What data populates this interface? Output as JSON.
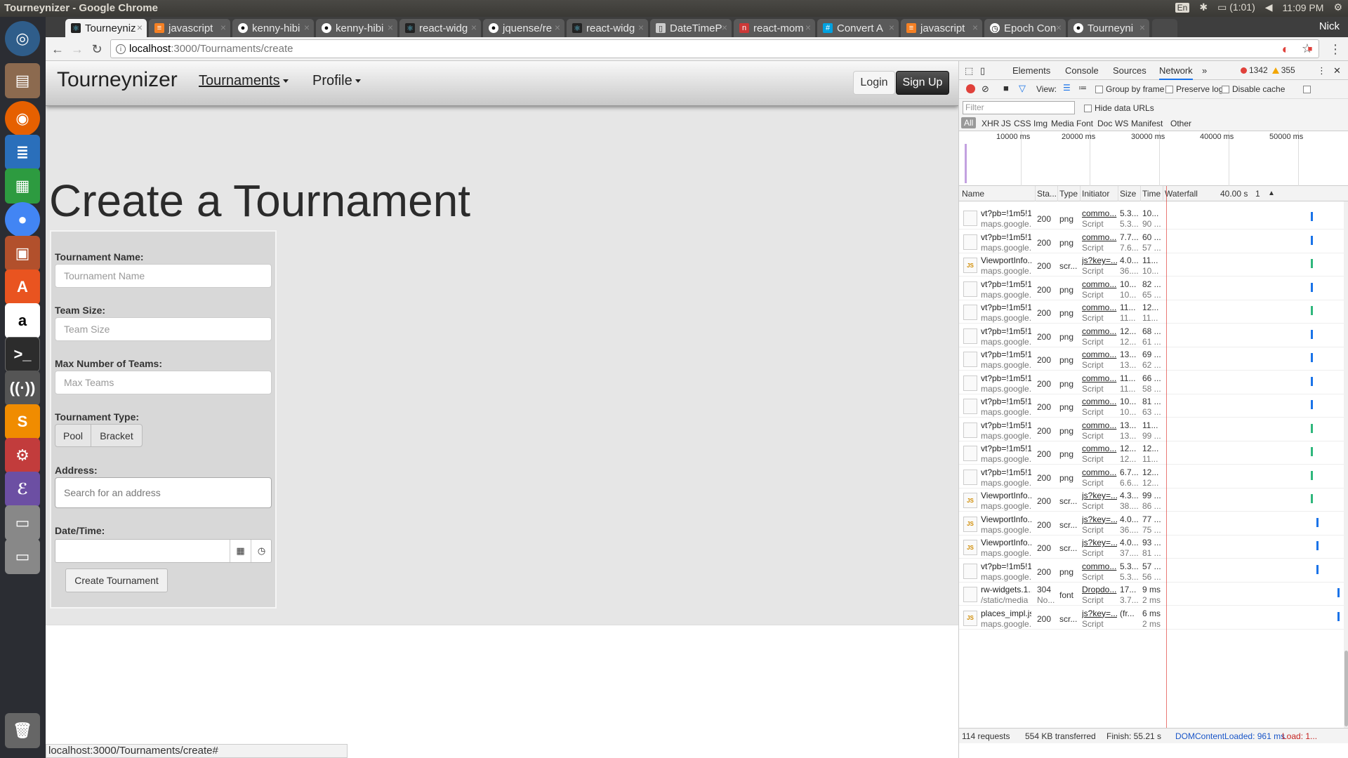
{
  "os": {
    "window_title": "Tourneynizer - Google Chrome",
    "keyboard": "En",
    "battery": "(1:01)",
    "clock": "11:09 PM",
    "user": "Nick"
  },
  "launcher": {
    "items": [
      "ubuntu-dash",
      "files",
      "firefox",
      "libreoffice-writer",
      "libreoffice-calc",
      "chrome",
      "libreoffice-impress",
      "software-center",
      "amazon",
      "terminal",
      "wifi",
      "sublime-text",
      "system-settings",
      "emacs",
      "drive",
      "drive-2",
      "trash"
    ]
  },
  "browser": {
    "tabs": [
      {
        "label": "Tourneyniz",
        "active": true
      },
      {
        "label": "javascript"
      },
      {
        "label": "kenny-hibi"
      },
      {
        "label": "kenny-hibi"
      },
      {
        "label": "react-widg"
      },
      {
        "label": "jquense/re"
      },
      {
        "label": "react-widg"
      },
      {
        "label": "DateTimeP"
      },
      {
        "label": "react-mom"
      },
      {
        "label": "Convert A"
      },
      {
        "label": "javascript"
      },
      {
        "label": "Epoch Con"
      },
      {
        "label": "Tourneyni"
      }
    ],
    "profile": "Nick",
    "url_host": "localhost",
    "url_path": ":3000/Tournaments/create",
    "status_url": "localhost:3000/Tournaments/create#"
  },
  "app": {
    "brand": "Tourneynizer",
    "nav": {
      "tournaments": "Tournaments",
      "profile": "Profile"
    },
    "login": "Login",
    "signup": "Sign Up",
    "page_title": "Create a Tournament",
    "form": {
      "name_label": "Tournament Name:",
      "name_placeholder": "Tournament Name",
      "team_size_label": "Team Size:",
      "team_size_placeholder": "Team Size",
      "max_teams_label": "Max Number of Teams:",
      "max_teams_placeholder": "Max Teams",
      "type_label": "Tournament Type:",
      "type_options": [
        "Pool",
        "Bracket"
      ],
      "address_label": "Address:",
      "address_placeholder": "Search for an address",
      "datetime_label": "Date/Time:",
      "submit": "Create Tournament"
    }
  },
  "devtools": {
    "tabs": [
      "Elements",
      "Console",
      "Sources",
      "Network"
    ],
    "active_tab": "Network",
    "errors": "1342",
    "warnings": "355",
    "view_label": "View:",
    "group_by_frame": "Group by frame",
    "preserve_log": "Preserve log",
    "disable_cache": "Disable cache",
    "filter_placeholder": "Filter",
    "hide_data_urls": "Hide data URLs",
    "filter_types": [
      "All",
      "XHR",
      "JS",
      "CSS",
      "Img",
      "Media",
      "Font",
      "Doc",
      "WS",
      "Manifest",
      "Other"
    ],
    "timeline_labels": [
      "10000 ms",
      "20000 ms",
      "30000 ms",
      "40000 ms",
      "50000 ms"
    ],
    "columns": [
      "Name",
      "Sta...",
      "Type",
      "Initiator",
      "Size",
      "Time",
      "Waterfall"
    ],
    "waterfall_scale": "40.00 s",
    "waterfall_page": "1",
    "requests": [
      {
        "name": "vt?pb=!1m5!1...",
        "domain": "maps.google...",
        "status": "200",
        "type": "png",
        "initiator": "commo...",
        "init_type": "Script",
        "size1": "5.3...",
        "size2": "5.3...",
        "time1": "10...",
        "time2": "90 ...",
        "wf": 0.84,
        "color": "#1a73e8"
      },
      {
        "name": "vt?pb=!1m5!1...",
        "domain": "maps.google...",
        "status": "200",
        "type": "png",
        "initiator": "commo...",
        "init_type": "Script",
        "size1": "7.7...",
        "size2": "7.6...",
        "time1": "60 ...",
        "time2": "57 ...",
        "wf": 0.84,
        "color": "#1a73e8"
      },
      {
        "name": "ViewportInfo...",
        "domain": "maps.google...",
        "status": "200",
        "type": "scr...",
        "initiator": "js?key=...",
        "init_type": "Script",
        "size1": "4.0...",
        "size2": "36....",
        "time1": "11...",
        "time2": "10...",
        "wf": 0.84,
        "color": "#2fb77c",
        "js": true
      },
      {
        "name": "vt?pb=!1m5!1...",
        "domain": "maps.google...",
        "status": "200",
        "type": "png",
        "initiator": "commo...",
        "init_type": "Script",
        "size1": "10...",
        "size2": "10...",
        "time1": "82 ...",
        "time2": "65 ...",
        "wf": 0.84,
        "color": "#1a73e8"
      },
      {
        "name": "vt?pb=!1m5!1...",
        "domain": "maps.google...",
        "status": "200",
        "type": "png",
        "initiator": "commo...",
        "init_type": "Script",
        "size1": "11...",
        "size2": "11...",
        "time1": "12...",
        "time2": "11...",
        "wf": 0.84,
        "color": "#2fb77c"
      },
      {
        "name": "vt?pb=!1m5!1...",
        "domain": "maps.google...",
        "status": "200",
        "type": "png",
        "initiator": "commo...",
        "init_type": "Script",
        "size1": "12...",
        "size2": "12...",
        "time1": "68 ...",
        "time2": "61 ...",
        "wf": 0.84,
        "color": "#1a73e8"
      },
      {
        "name": "vt?pb=!1m5!1...",
        "domain": "maps.google...",
        "status": "200",
        "type": "png",
        "initiator": "commo...",
        "init_type": "Script",
        "size1": "13...",
        "size2": "13...",
        "time1": "69 ...",
        "time2": "62 ...",
        "wf": 0.84,
        "color": "#1a73e8"
      },
      {
        "name": "vt?pb=!1m5!1...",
        "domain": "maps.google...",
        "status": "200",
        "type": "png",
        "initiator": "commo...",
        "init_type": "Script",
        "size1": "11...",
        "size2": "11...",
        "time1": "66 ...",
        "time2": "58 ...",
        "wf": 0.84,
        "color": "#1a73e8"
      },
      {
        "name": "vt?pb=!1m5!1...",
        "domain": "maps.google...",
        "status": "200",
        "type": "png",
        "initiator": "commo...",
        "init_type": "Script",
        "size1": "10...",
        "size2": "10...",
        "time1": "81 ...",
        "time2": "63 ...",
        "wf": 0.84,
        "color": "#1a73e8"
      },
      {
        "name": "vt?pb=!1m5!1...",
        "domain": "maps.google...",
        "status": "200",
        "type": "png",
        "initiator": "commo...",
        "init_type": "Script",
        "size1": "13...",
        "size2": "13...",
        "time1": "11...",
        "time2": "99 ...",
        "wf": 0.84,
        "color": "#2fb77c"
      },
      {
        "name": "vt?pb=!1m5!1...",
        "domain": "maps.google...",
        "status": "200",
        "type": "png",
        "initiator": "commo...",
        "init_type": "Script",
        "size1": "12...",
        "size2": "12...",
        "time1": "12...",
        "time2": "11...",
        "wf": 0.84,
        "color": "#2fb77c"
      },
      {
        "name": "vt?pb=!1m5!1...",
        "domain": "maps.google...",
        "status": "200",
        "type": "png",
        "initiator": "commo...",
        "init_type": "Script",
        "size1": "6.7...",
        "size2": "6.6...",
        "time1": "12...",
        "time2": "12...",
        "wf": 0.84,
        "color": "#2fb77c"
      },
      {
        "name": "ViewportInfo...",
        "domain": "maps.google...",
        "status": "200",
        "type": "scr...",
        "initiator": "js?key=...",
        "init_type": "Script",
        "size1": "4.3...",
        "size2": "38....",
        "time1": "99 ...",
        "time2": "86 ...",
        "wf": 0.84,
        "color": "#2fb77c",
        "js": true
      },
      {
        "name": "ViewportInfo...",
        "domain": "maps.google...",
        "status": "200",
        "type": "scr...",
        "initiator": "js?key=...",
        "init_type": "Script",
        "size1": "4.0...",
        "size2": "36....",
        "time1": "77 ...",
        "time2": "75 ...",
        "wf": 0.87,
        "color": "#1a73e8",
        "js": true
      },
      {
        "name": "ViewportInfo...",
        "domain": "maps.google...",
        "status": "200",
        "type": "scr...",
        "initiator": "js?key=...",
        "init_type": "Script",
        "size1": "4.0...",
        "size2": "37....",
        "time1": "93 ...",
        "time2": "81 ...",
        "wf": 0.87,
        "color": "#1a73e8",
        "js": true
      },
      {
        "name": "vt?pb=!1m5!1...",
        "domain": "maps.google...",
        "status": "200",
        "type": "png",
        "initiator": "commo...",
        "init_type": "Script",
        "size1": "5.3...",
        "size2": "5.3...",
        "time1": "57 ...",
        "time2": "56 ...",
        "wf": 0.87,
        "color": "#1a73e8"
      },
      {
        "name": "rw-widgets.1...",
        "domain": "/static/media",
        "status": "304",
        "status2": "No...",
        "type": "font",
        "initiator": "Dropdo...",
        "init_type": "Script",
        "size1": "17...",
        "size2": "3.7...",
        "time1": "9 ms",
        "time2": "2 ms",
        "wf": 0.99,
        "color": "#1a73e8"
      },
      {
        "name": "places_impl.js",
        "domain": "maps.google...",
        "status": "200",
        "type": "scr...",
        "initiator": "js?key=...",
        "init_type": "Script",
        "size1": "(fr...",
        "size2": "",
        "time1": "6 ms",
        "time2": "2 ms",
        "wf": 0.99,
        "color": "#1a73e8",
        "js": true
      }
    ],
    "footer": {
      "requests": "114 requests",
      "transferred": "554 KB transferred",
      "finish": "Finish: 55.21 s",
      "dcl": "DOMContentLoaded: 961 ms",
      "load": "Load: 1..."
    }
  }
}
